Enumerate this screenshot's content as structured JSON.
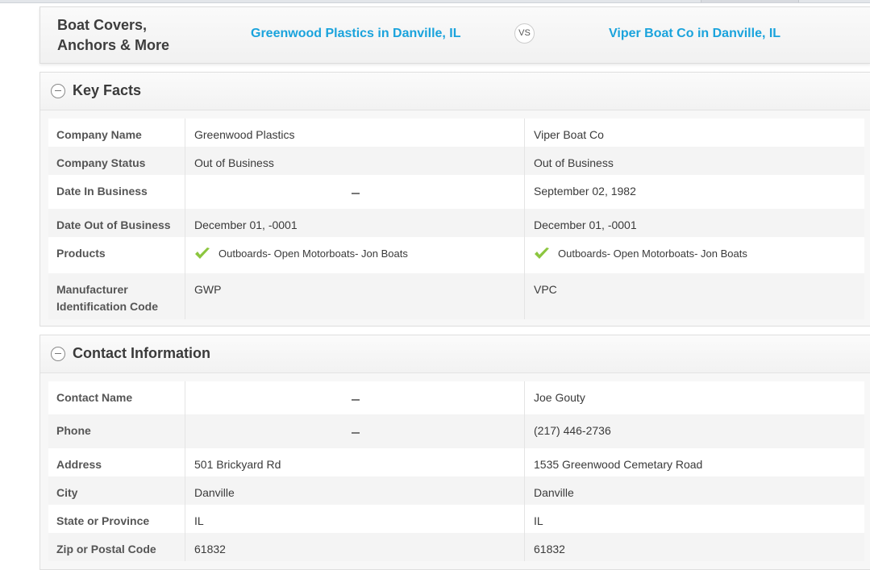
{
  "header": {
    "category": "Boat Covers, Anchors & More",
    "company1": "Greenwood Plastics in Danville, IL",
    "vs": "VS",
    "company2": "Viper Boat Co in Danville, IL"
  },
  "key_facts": {
    "title": "Key Facts",
    "rows": [
      {
        "label": "Company Name",
        "v1": "Greenwood Plastics",
        "v2": "Viper Boat Co"
      },
      {
        "label": "Company Status",
        "v1": "Out of Business",
        "v2": "Out of Business"
      },
      {
        "label": "Date In Business",
        "v1": "",
        "v2": "September 02, 1982"
      },
      {
        "label": "Date Out of Business",
        "v1": "December 01, -0001",
        "v2": "December 01, -0001"
      },
      {
        "label": "Products",
        "v1": "Outboards- Open Motorboats- Jon Boats",
        "v2": "Outboards- Open Motorboats- Jon Boats"
      },
      {
        "label": "Manufacturer Identification Code",
        "v1": "GWP",
        "v2": "VPC"
      }
    ]
  },
  "contact": {
    "title": "Contact Information",
    "rows": [
      {
        "label": "Contact Name",
        "v1": "",
        "v2": "Joe Gouty"
      },
      {
        "label": "Phone",
        "v1": "",
        "v2": "(217) 446-2736"
      },
      {
        "label": "Address",
        "v1": "501 Brickyard Rd",
        "v2": "1535 Greenwood Cemetary Road"
      },
      {
        "label": "City",
        "v1": "Danville",
        "v2": "Danville"
      },
      {
        "label": "State or Province",
        "v1": "IL",
        "v2": "IL"
      },
      {
        "label": "Zip or Postal Code",
        "v1": "61832",
        "v2": "61832"
      }
    ]
  },
  "colors": {
    "link": "#1aa3dc",
    "check": "#8cc63f"
  }
}
